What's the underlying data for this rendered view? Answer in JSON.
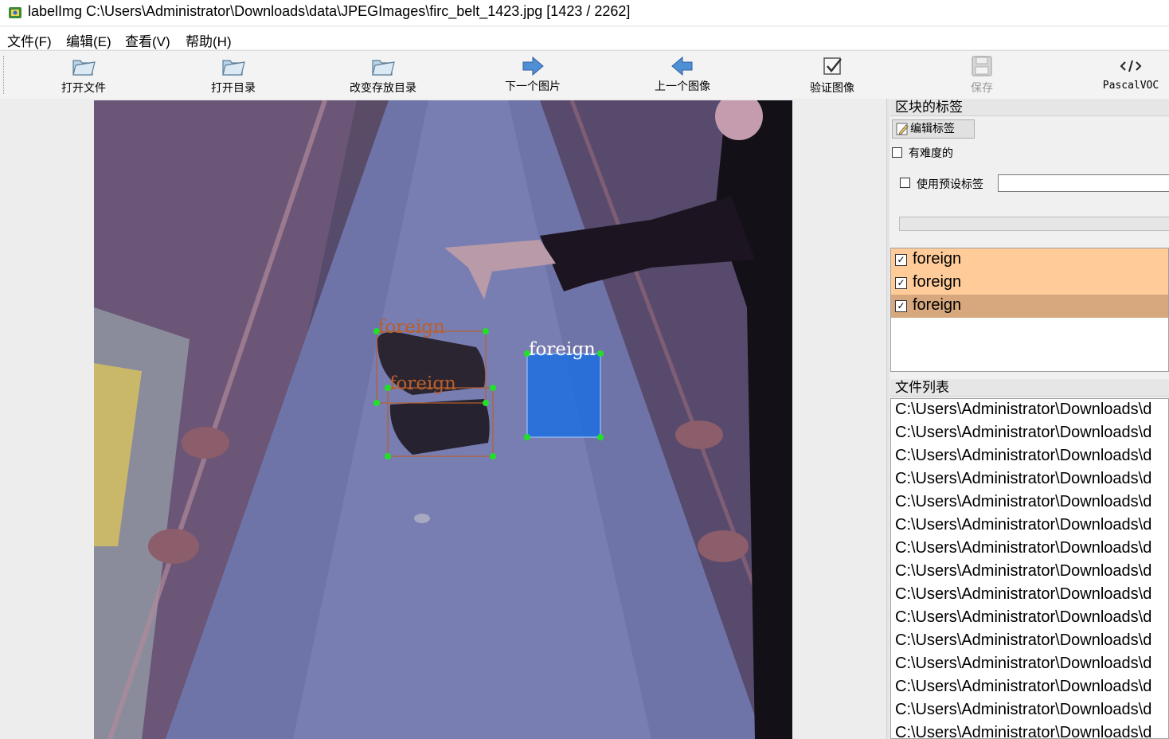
{
  "window": {
    "title": "labelImg C:\\Users\\Administrator\\Downloads\\data\\JPEGImages\\firc_belt_1423.jpg [1423 / 2262]"
  },
  "menu": {
    "file": "文件(F)",
    "edit": "编辑(E)",
    "view": "查看(V)",
    "help": "帮助(H)"
  },
  "toolbar": {
    "open_file": "打开文件",
    "open_dir": "打开目录",
    "change_save_dir": "改变存放目录",
    "next_image": "下一个图片",
    "prev_image": "上一个图像",
    "verify_image": "验证图像",
    "save": "保存",
    "format": "PascalVOC"
  },
  "annotations": [
    {
      "label": "foreign",
      "state": "normal"
    },
    {
      "label": "foreign",
      "state": "normal"
    },
    {
      "label": "foreign",
      "state": "selected"
    }
  ],
  "box_labels": {
    "first": "foreign",
    "second": "foreign",
    "third": "foreign"
  },
  "right_panel": {
    "labels_title": "区块的标签",
    "edit_label_button": "编辑标签",
    "difficult": "有难度的",
    "use_default_label": "使用预设标签",
    "default_label_value": "",
    "file_list_title": "文件列表"
  },
  "label_list": [
    {
      "text": "foreign",
      "checked": true,
      "color": "#ffcc99"
    },
    {
      "text": "foreign",
      "checked": true,
      "color": "#ffcc99"
    },
    {
      "text": "foreign",
      "checked": true,
      "color": "#d7a77d"
    }
  ],
  "file_list": [
    "C:\\Users\\Administrator\\Downloads\\d",
    "C:\\Users\\Administrator\\Downloads\\d",
    "C:\\Users\\Administrator\\Downloads\\d",
    "C:\\Users\\Administrator\\Downloads\\d",
    "C:\\Users\\Administrator\\Downloads\\d",
    "C:\\Users\\Administrator\\Downloads\\d",
    "C:\\Users\\Administrator\\Downloads\\d",
    "C:\\Users\\Administrator\\Downloads\\d",
    "C:\\Users\\Administrator\\Downloads\\d",
    "C:\\Users\\Administrator\\Downloads\\d",
    "C:\\Users\\Administrator\\Downloads\\d",
    "C:\\Users\\Administrator\\Downloads\\d",
    "C:\\Users\\Administrator\\Downloads\\d",
    "C:\\Users\\Administrator\\Downloads\\d",
    "C:\\Users\\Administrator\\Downloads\\d"
  ],
  "colors": {
    "box_outline": "#b8602c",
    "vertex": "#22e02a",
    "selected_fill": "#1f6fe0",
    "label_item": "#ffcc99",
    "label_item_selected": "#d7a77d"
  },
  "icons": [
    "open-folder-icon",
    "arrow-right-icon",
    "arrow-left-icon",
    "verify-check-icon",
    "save-disk-icon",
    "code-tag-icon",
    "edit-pencil-icon",
    "app-icon"
  ]
}
